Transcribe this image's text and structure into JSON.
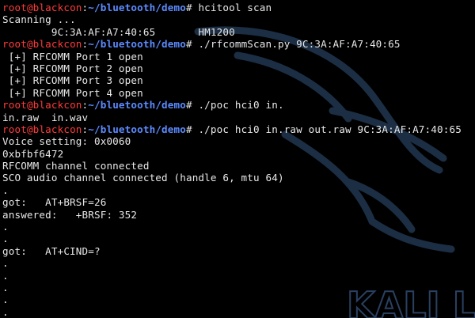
{
  "colors": {
    "background": "#000000",
    "text": "#e8e8e8",
    "user_host": "#ff3a3a",
    "path": "#5b8bff",
    "watermark": "#1c2e44"
  },
  "watermark": {
    "text": "KALI LI"
  },
  "prompt": {
    "user": "root",
    "at": "@",
    "host": "blackcon",
    "colon": ":",
    "path": "~/bluetooth/demo",
    "symbol": "# "
  },
  "lines": [
    {
      "kind": "prompt",
      "cmd": "hcitool scan"
    },
    {
      "kind": "out",
      "text": "Scanning ..."
    },
    {
      "kind": "out",
      "text": "        9C:3A:AF:A7:40:65       HM1200"
    },
    {
      "kind": "prompt",
      "cmd": "./rfcommScan.py 9C:3A:AF:A7:40:65"
    },
    {
      "kind": "out",
      "text": " [+] RFCOMM Port 1 open"
    },
    {
      "kind": "out",
      "text": " [+] RFCOMM Port 2 open"
    },
    {
      "kind": "out",
      "text": " [+] RFCOMM Port 3 open"
    },
    {
      "kind": "out",
      "text": " [+] RFCOMM Port 4 open"
    },
    {
      "kind": "prompt",
      "cmd": "./poc hci0 in."
    },
    {
      "kind": "out",
      "text": "in.raw  in.wav"
    },
    {
      "kind": "prompt",
      "cmd": "./poc hci0 in.raw out.raw 9C:3A:AF:A7:40:65"
    },
    {
      "kind": "out",
      "text": "Voice setting: 0x0060"
    },
    {
      "kind": "out",
      "text": "0xbfbf6472"
    },
    {
      "kind": "out",
      "text": "RFCOMM channel connected"
    },
    {
      "kind": "out",
      "text": "SCO audio channel connected (handle 6, mtu 64)"
    },
    {
      "kind": "out",
      "text": "."
    },
    {
      "kind": "out",
      "text": "got:   AT+BRSF=26"
    },
    {
      "kind": "out",
      "text": "answered:   +BRSF: 352"
    },
    {
      "kind": "out",
      "text": "."
    },
    {
      "kind": "out",
      "text": "."
    },
    {
      "kind": "out",
      "text": "got:   AT+CIND=?"
    },
    {
      "kind": "out",
      "text": "."
    },
    {
      "kind": "out",
      "text": "."
    },
    {
      "kind": "out",
      "text": "."
    },
    {
      "kind": "out",
      "text": "."
    },
    {
      "kind": "out",
      "text": "."
    }
  ]
}
